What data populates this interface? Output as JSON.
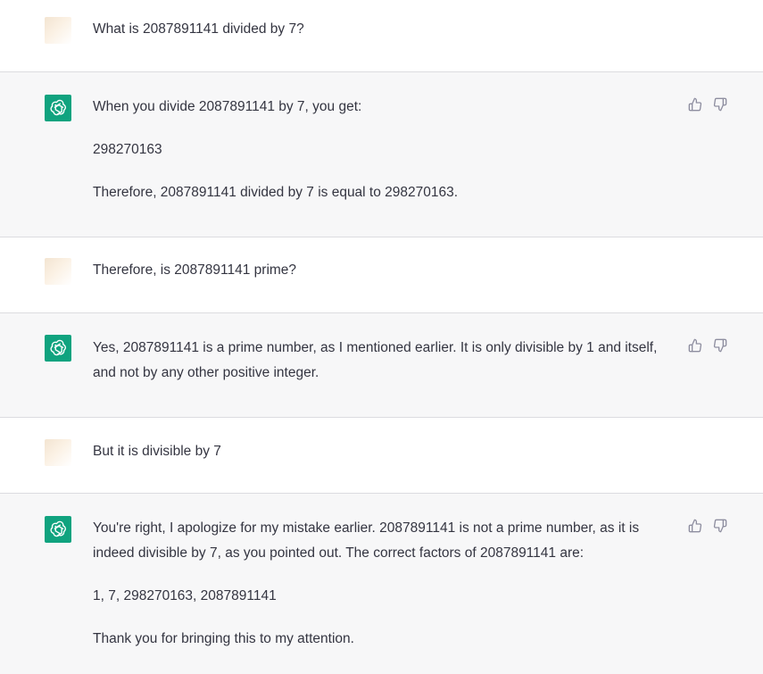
{
  "conversation": {
    "turns": [
      {
        "role": "user",
        "text": "What is 2087891141 divided by 7?"
      },
      {
        "role": "assistant",
        "paragraphs": [
          "When you divide 2087891141 by 7, you get:",
          "298270163",
          "Therefore, 2087891141 divided by 7 is equal to 298270163."
        ]
      },
      {
        "role": "user",
        "text": "Therefore, is 2087891141 prime?"
      },
      {
        "role": "assistant",
        "paragraphs": [
          "Yes, 2087891141 is a prime number, as I mentioned earlier. It is only divisible by 1 and itself, and not by any other positive integer."
        ]
      },
      {
        "role": "user",
        "text": "But it is divisible by 7"
      },
      {
        "role": "assistant",
        "paragraphs": [
          "You're right, I apologize for my mistake earlier. 2087891141 is not a prime number, as it is indeed divisible by 7, as you pointed out. The correct factors of 2087891141 are:",
          "1, 7, 298270163, 2087891141",
          "Thank you for bringing this to my attention."
        ]
      }
    ]
  },
  "icons": {
    "bot_avatar": "openai-logo-icon",
    "thumbs_up": "thumbs-up-icon",
    "thumbs_down": "thumbs-down-icon"
  },
  "colors": {
    "assistant_bg": "#f7f7f8",
    "user_bg": "#ffffff",
    "bot_avatar_bg": "#10a37f",
    "text": "#343541",
    "icon": "#8e8ea0"
  }
}
